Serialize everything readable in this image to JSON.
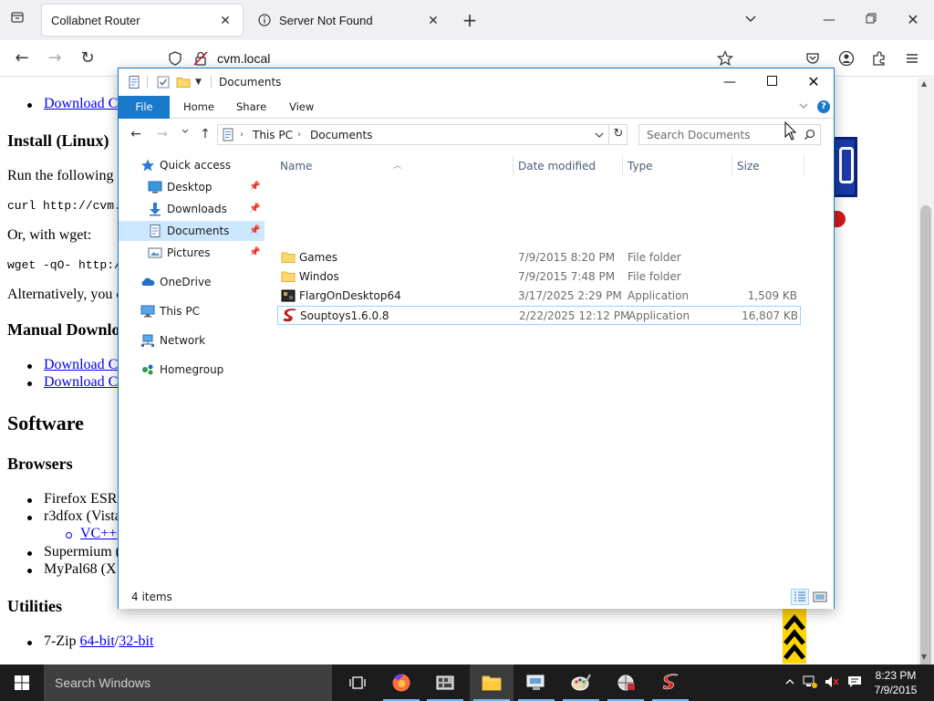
{
  "browser": {
    "tabs": [
      {
        "title": "Collabnet Router",
        "active": true
      },
      {
        "title": "Server Not Found",
        "active": false
      }
    ],
    "url": "cvm.local"
  },
  "webpage": {
    "link_download_1": "Download C",
    "heading_install_linux": "Install (Linux)",
    "run_following": "Run the following",
    "curl_cmd": "curl http://cvm.lo",
    "or_wget": "Or, with wget:",
    "wget_cmd": "wget -qO- http://c",
    "alternatively": "Alternatively, you c",
    "heading_manual": "Manual Downlo",
    "link_download_2": "Download C",
    "link_download_3": "Download C",
    "heading_software": "Software",
    "heading_browsers": "Browsers",
    "item_firefox": "Firefox ESR",
    "item_r3dfox": "r3dfox (Vista",
    "link_vc": "VC++",
    "item_supermium": "Supermium (",
    "item_mypal": "MyPal68 (X",
    "heading_utilities": "Utilities",
    "item_7zip_prefix": "7-Zip ",
    "link_64bit": "64-bit",
    "slash": "/",
    "link_32bit": "32-bit"
  },
  "explorer": {
    "title": "Documents",
    "ribbon_tabs": [
      "File",
      "Home",
      "Share",
      "View"
    ],
    "breadcrumb": [
      "This PC",
      "Documents"
    ],
    "search_placeholder": "Search Documents",
    "nav": {
      "quick_access": "Quick access",
      "desktop": "Desktop",
      "downloads": "Downloads",
      "documents": "Documents",
      "pictures": "Pictures",
      "onedrive": "OneDrive",
      "this_pc": "This PC",
      "network": "Network",
      "homegroup": "Homegroup"
    },
    "columns": {
      "name": "Name",
      "date": "Date modified",
      "type": "Type",
      "size": "Size"
    },
    "files": [
      {
        "name": "Games",
        "date": "7/9/2015 8:20 PM",
        "type": "File folder",
        "size": "",
        "icon": "folder-icon"
      },
      {
        "name": "Windos",
        "date": "7/9/2015 7:48 PM",
        "type": "File folder",
        "size": "",
        "icon": "folder-icon"
      },
      {
        "name": "FlargOnDesktop64",
        "date": "3/17/2025 2:29 PM",
        "type": "Application",
        "size": "1,509 KB",
        "icon": "app-icon"
      },
      {
        "name": "Souptoys1.6.0.8",
        "date": "2/22/2025 12:12 PM",
        "type": "Application",
        "size": "16,807 KB",
        "icon": "souptoys-icon"
      }
    ],
    "status_count": "4 items"
  },
  "taskbar": {
    "search_placeholder": "Search Windows",
    "time": "8:23 PM",
    "date": "7/9/2015"
  },
  "colors": {
    "accent": "#1979ca",
    "selection": "#cce8ff",
    "taskbar": "#1c1c1c",
    "link": "#0000ee"
  }
}
